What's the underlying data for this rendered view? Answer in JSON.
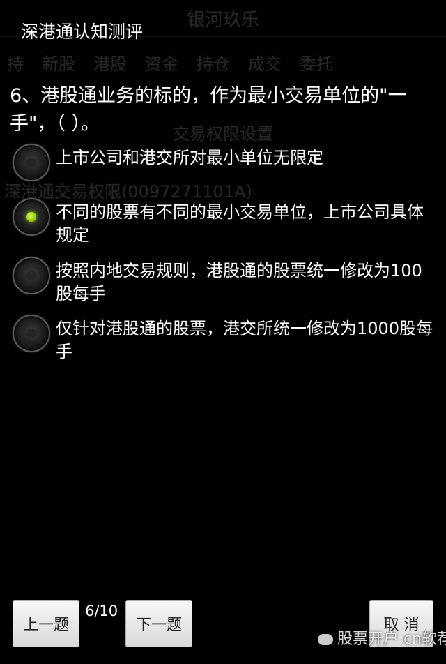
{
  "background": {
    "title": "银河玖乐",
    "tabs": [
      "持",
      "新股",
      "港股",
      "资金",
      "持仓",
      "成交",
      "委托"
    ],
    "subbar": "交易权限设置",
    "row": "深港通交易权限(0097271101A)"
  },
  "dialog": {
    "title": "深港通认知测评",
    "question": "6、港股通业务的标的，作为最小交易单位的\"一手\"，（   ）。",
    "options": [
      {
        "label": "上市公司和港交所对最小单位无限定",
        "selected": false
      },
      {
        "label": "不同的股票有不同的最小交易单位，上市公司具体规定",
        "selected": true
      },
      {
        "label": "按照内地交易规则，港股通的股票统一修改为100股每手",
        "selected": false
      },
      {
        "label": "仅针对港股通的股票，港交所统一修改为1000股每手",
        "selected": false
      }
    ]
  },
  "footer": {
    "prev_label": "上一题",
    "progress": "6/10",
    "next_label": "下一题",
    "cancel_label": "取 消"
  },
  "watermark": "股票开户 cn软荐网",
  "colors": {
    "selected_radio": "#99cc00",
    "button_bg": "#e8e8e8"
  }
}
